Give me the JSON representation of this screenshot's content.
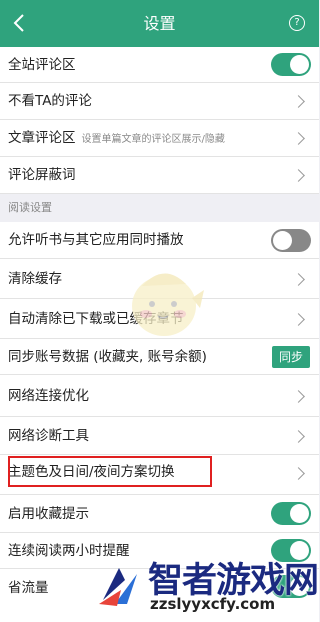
{
  "header": {
    "title": "设置",
    "help_glyph": "?"
  },
  "rows": [
    {
      "label": "全站评论区",
      "control": "toggle",
      "state": "on"
    },
    {
      "label": "不看TA的评论",
      "control": "chevron"
    },
    {
      "label": "文章评论区",
      "sub": "设置单篇文章的评论区展示/隐藏",
      "control": "chevron"
    },
    {
      "label": "评论屏蔽词",
      "control": "chevron"
    }
  ],
  "section": {
    "title": "阅读设置"
  },
  "reading_rows": [
    {
      "label": "允许听书与其它应用同时播放",
      "control": "toggle",
      "state": "off"
    },
    {
      "label": "清除缓存",
      "control": "chevron"
    },
    {
      "label": "自动清除已下载或已缓存章节",
      "control": "chevron"
    },
    {
      "label": "同步账号数据 (收藏夹, 账号余额)",
      "control": "button",
      "button_label": "同步"
    },
    {
      "label": "网络连接优化",
      "control": "chevron"
    },
    {
      "label": "网络诊断工具",
      "control": "chevron"
    },
    {
      "label": "主题色及日间/夜间方案切换",
      "control": "chevron"
    },
    {
      "label": "启用收藏提示",
      "control": "toggle",
      "state": "on"
    },
    {
      "label": "连续阅读两小时提醒",
      "control": "toggle",
      "state": "on"
    },
    {
      "label": "省流量",
      "control": "toggle",
      "state": "on"
    }
  ],
  "watermark": {
    "brand": "智者游戏网",
    "url": "zzslyyxcfy.com"
  },
  "colors": {
    "accent": "#2fa37d",
    "highlight": "#e02020"
  }
}
